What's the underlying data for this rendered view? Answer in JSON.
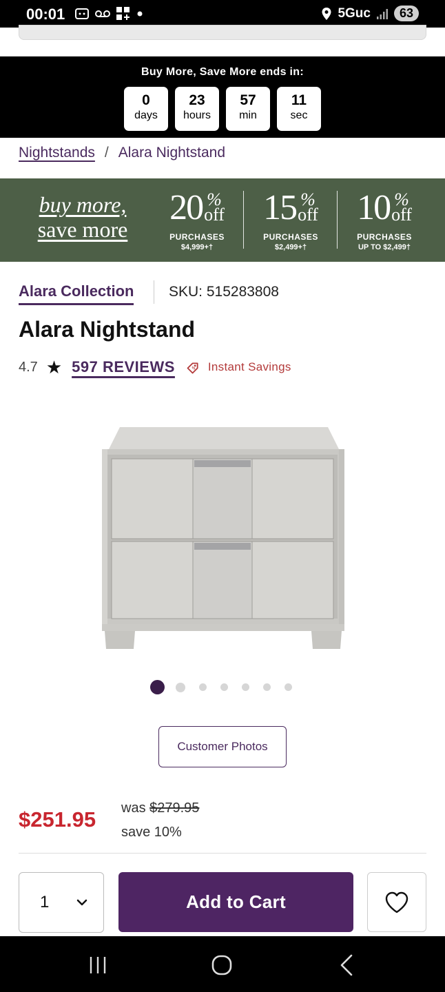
{
  "status_bar": {
    "time": "00:01",
    "network": "5Guc",
    "battery": "63",
    "icons": [
      "screenshot-icon",
      "voicemail-icon",
      "app-grid-icon",
      "dot-icon",
      "location-icon",
      "signal-icon",
      "battery-icon"
    ]
  },
  "countdown": {
    "title": "Buy More, Save More ends in:",
    "units": [
      {
        "value": "0",
        "label": "days"
      },
      {
        "value": "23",
        "label": "hours"
      },
      {
        "value": "57",
        "label": "min"
      },
      {
        "value": "11",
        "label": "sec"
      }
    ]
  },
  "breadcrumb": {
    "parent": "Nightstands",
    "separator": "/",
    "current": "Alara Nightstand"
  },
  "promo": {
    "line1": "buy more,",
    "line2": "save more",
    "tiers": [
      {
        "pct": "20",
        "pct_sym": "%",
        "off": "off",
        "label": "PURCHASES",
        "amount": "$4,999+†"
      },
      {
        "pct": "15",
        "pct_sym": "%",
        "off": "off",
        "label": "PURCHASES",
        "amount": "$2,499+†"
      },
      {
        "pct": "10",
        "pct_sym": "%",
        "off": "off",
        "label": "PURCHASES",
        "amount": "UP TO $2,499†"
      }
    ],
    "colors": {
      "background": "#4d5f47"
    }
  },
  "product": {
    "collection": "Alara Collection",
    "sku": "SKU: 515283808",
    "name": "Alara Nightstand",
    "rating": "4.7",
    "reviews": "597 REVIEWS",
    "savings": "Instant Savings",
    "customer_photos": "Customer Photos",
    "price": "$251.95",
    "was_label": "was ",
    "was_price": "$279.95",
    "save": "save 10%",
    "quantity": "1",
    "add_to_cart": "Add to Cart",
    "carousel": {
      "count": 7,
      "active_index": 0
    }
  },
  "colors": {
    "accent": "#4e2563",
    "price_red": "#c8262f",
    "link_purple": "#4a2a5e"
  }
}
